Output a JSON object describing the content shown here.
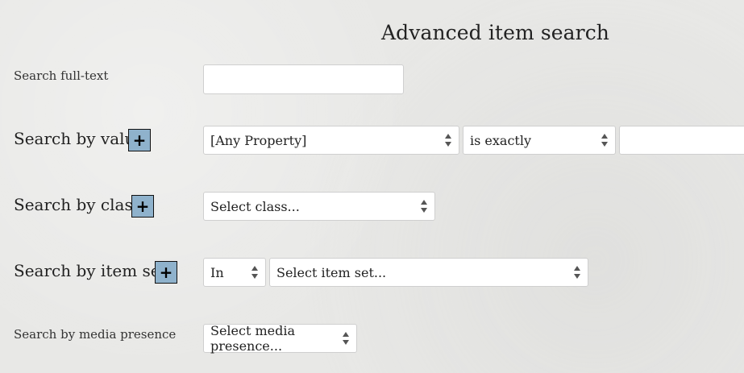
{
  "page": {
    "title": "Advanced item search"
  },
  "fulltext": {
    "label": "Search full-text",
    "value": ""
  },
  "by_value": {
    "label": "Search by value",
    "add_label": "+",
    "property_select": "[Any Property]",
    "operator_select": "is exactly",
    "value_input": ""
  },
  "by_class": {
    "label": "Search by class",
    "add_label": "+",
    "class_select": "Select class..."
  },
  "by_item_set": {
    "label": "Search by item set",
    "add_label": "+",
    "in_select": "In",
    "item_set_select": "Select item set..."
  },
  "by_media": {
    "label": "Search by media presence",
    "media_select": "Select media presence..."
  },
  "colors": {
    "add_button_bg": "#8fb2cc",
    "caret": "#1f5aa6"
  },
  "icons": {
    "add": "plus-icon",
    "expand": "caret-right-icon",
    "select": "updown-arrows-icon"
  }
}
